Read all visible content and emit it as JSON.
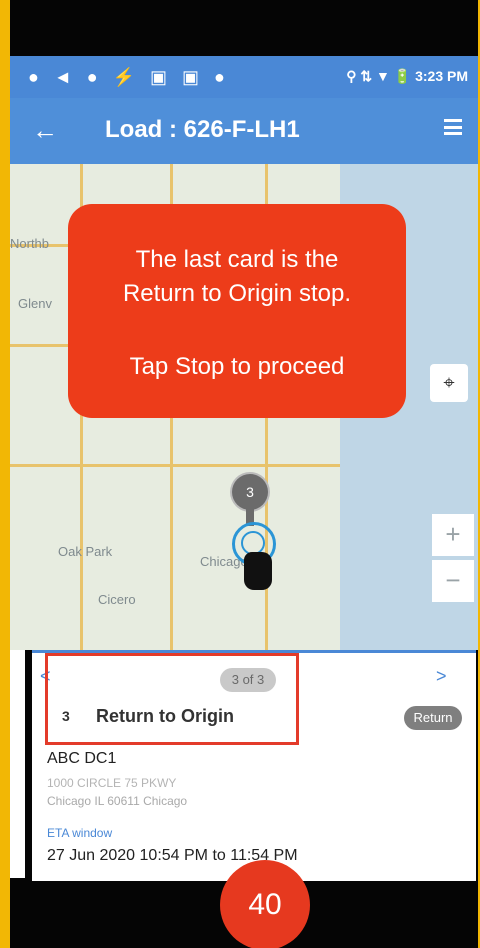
{
  "status_bar": {
    "icons": "● ◄ ● ⚡ ▣ ▣ ●",
    "right": "⚲ ⇅ ▼ 🔋 3:23 PM"
  },
  "app_bar": {
    "back_icon": "←",
    "title": "Load : 626-F-LH1",
    "menu_icon": "menu-icon"
  },
  "map_labels": {
    "north": "Northb",
    "glenview": "Glenv",
    "oak_park": "Oak Park",
    "cicero": "Cicero",
    "chicago": "Chicago"
  },
  "locate_icon": "⌖",
  "zoom": {
    "in": "+",
    "out": "−"
  },
  "callout": {
    "line1": "The last card is the",
    "line2": "Return to Origin stop.",
    "line3": "Tap Stop to proceed"
  },
  "pin": {
    "number": "3"
  },
  "card": {
    "prev": "<",
    "next": ">",
    "pager": "3 of 3",
    "stop_number": "3",
    "stop_name": "Return to Origin",
    "badge": "Return",
    "dc": "ABC DC1",
    "address": "1000 CIRCLE 75 PKWY",
    "city": "Chicago IL 60611 Chicago",
    "eta_label": "ETA window",
    "eta_value": "27 Jun 2020 10:54 PM to 11:54 PM"
  },
  "page_number": "40"
}
